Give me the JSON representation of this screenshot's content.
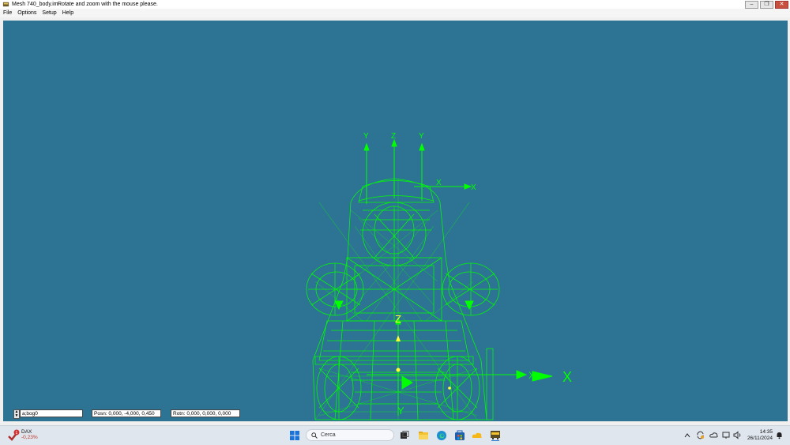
{
  "window": {
    "title": "Mesh 740_body.im",
    "hint": "Rotate and zoom with the mouse please.",
    "buttons": [
      "–",
      "❐",
      "✕"
    ]
  },
  "menu": [
    "File",
    "Options",
    "Setup",
    "Help"
  ],
  "viewport": {
    "background": "#2d7394",
    "wire_color": "#00ff00",
    "axis_labels": [
      "Y",
      "Z",
      "Y",
      "X",
      "X",
      "Z",
      "X",
      "X",
      "Y"
    ]
  },
  "status": {
    "object_name": "a;bog0",
    "position": "Posn: 0,000, -4,000, 0,450",
    "rotation": "Rotn: 0,000, 0,000, 0,000"
  },
  "taskbar": {
    "ticker_name": "DAX",
    "ticker_value": "-0,23%",
    "search_placeholder": "Cerca",
    "time": "14:35",
    "date": "26/11/2024",
    "notification_count": "1"
  }
}
